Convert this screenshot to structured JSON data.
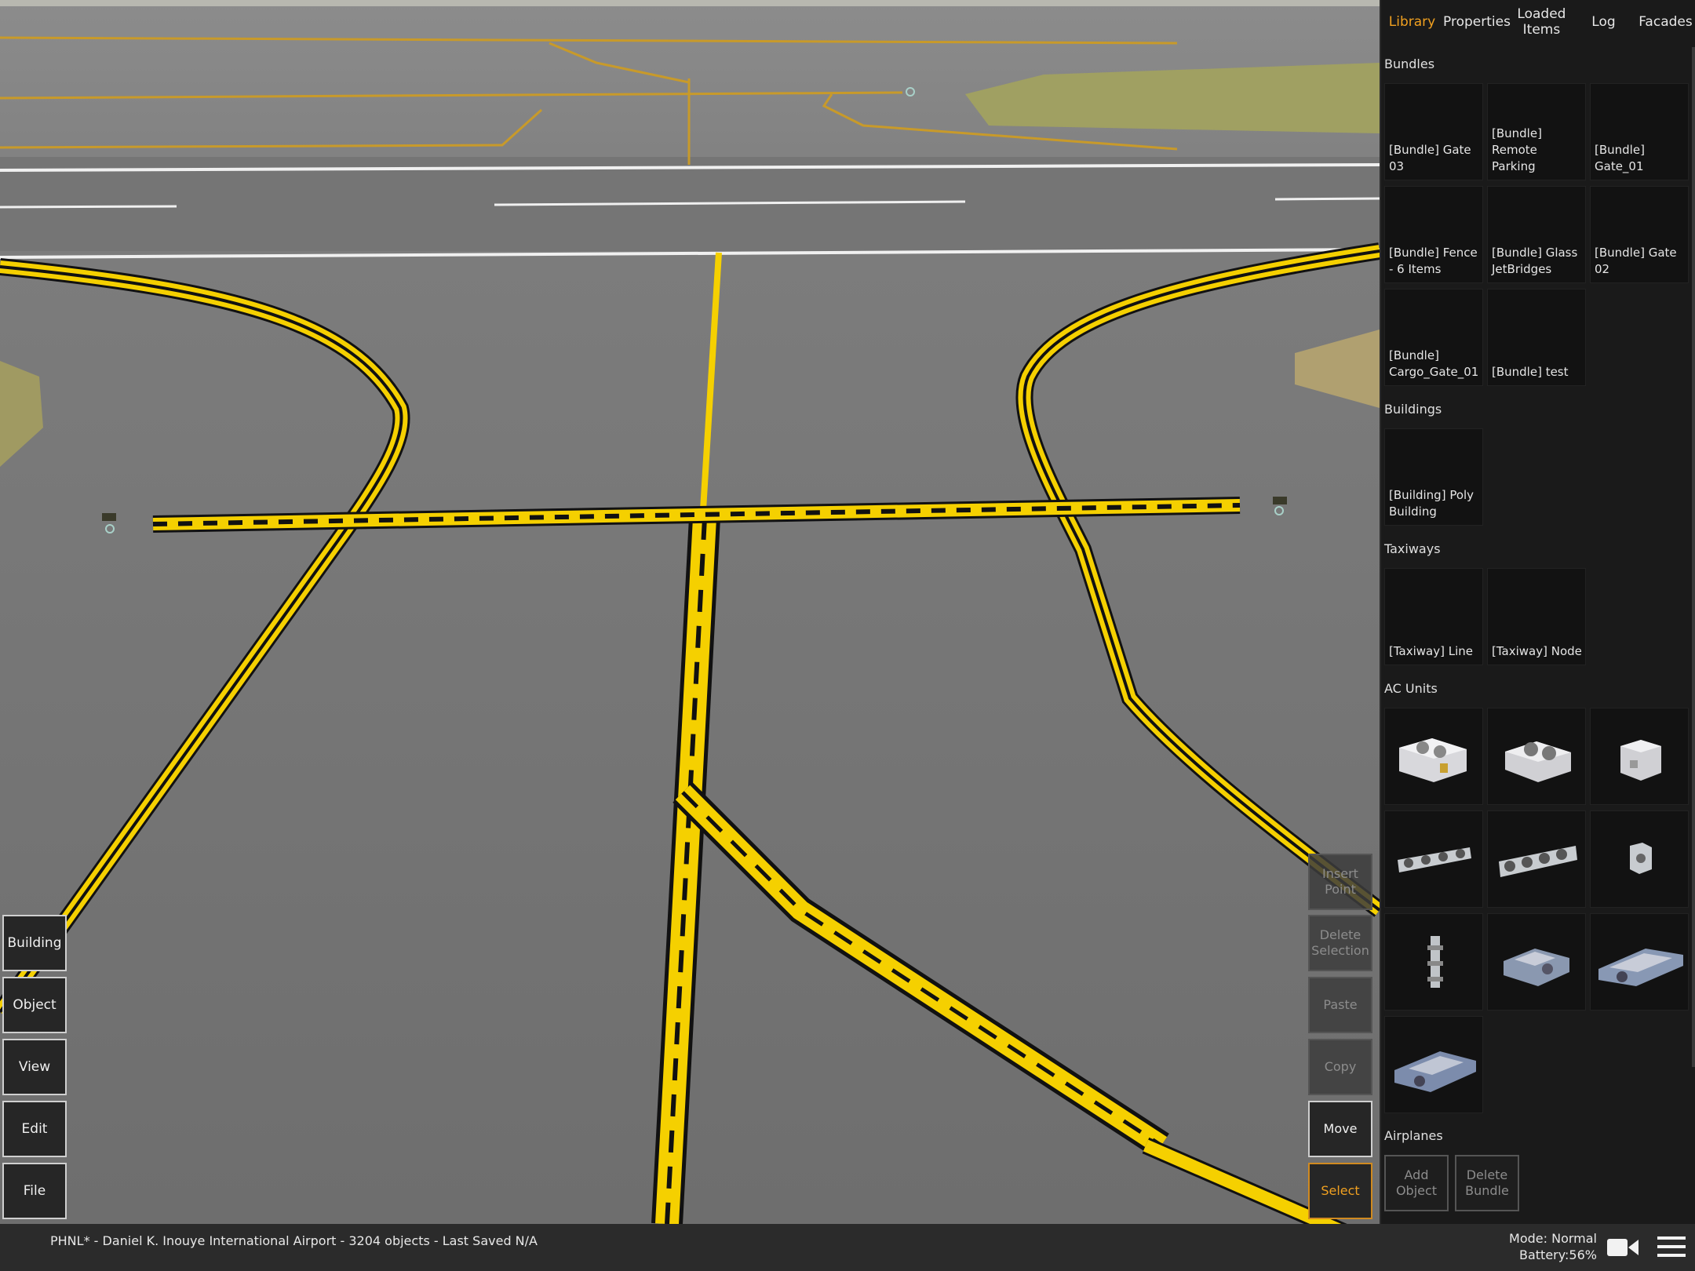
{
  "tabs": [
    {
      "label": "Library",
      "active": true
    },
    {
      "label": "Properties",
      "active": false
    },
    {
      "label": "Loaded Items",
      "active": false
    },
    {
      "label": "Log",
      "active": false
    },
    {
      "label": "Facades",
      "active": false
    }
  ],
  "library": {
    "bundles": {
      "title": "Bundles",
      "items": [
        "[Bundle] Gate 03",
        "[Bundle] Remote Parking",
        "[Bundle] Gate_01",
        "[Bundle] Fence - 6 Items",
        "[Bundle] Glass JetBridges",
        "[Bundle] Gate 02",
        "[Bundle] Cargo_Gate_01",
        "[Bundle] test"
      ]
    },
    "buildings": {
      "title": "Buildings",
      "items": [
        "[Building] Poly Building"
      ]
    },
    "taxiways": {
      "title": "Taxiways",
      "items": [
        "[Taxiway] Line",
        "[Taxiway] Node"
      ]
    },
    "ac_units": {
      "title": "AC Units",
      "items": [
        "ac-unit-1-icon",
        "ac-unit-2-icon",
        "ac-unit-3-icon",
        "ac-unit-row-4-icon",
        "ac-unit-row-5-icon",
        "ac-unit-small-icon",
        "ac-pipe-icon",
        "ac-machinery-1-icon",
        "ac-machinery-2-icon",
        "ac-machinery-3-icon"
      ]
    },
    "airplanes": {
      "title": "Airplanes"
    },
    "actions": {
      "add_object": "Add Object",
      "delete_bundle": "Delete Bundle"
    }
  },
  "left_toolbar": {
    "building": "Building",
    "object": "Object",
    "view": "View",
    "edit": "Edit",
    "file": "File"
  },
  "right_toolbar": {
    "insert_point": "Insert Point",
    "delete_selection": "Delete Selection",
    "paste": "Paste",
    "copy": "Copy",
    "move": "Move",
    "select": "Select"
  },
  "status": {
    "text": "PHNL* - Daniel K. Inouye International Airport - 3204 objects - Last Saved N/A",
    "mode": "Mode: Normal",
    "battery": "Battery:56%"
  },
  "colors": {
    "accent": "#f0a020",
    "taxiline": "#f5d000",
    "panel": "#1a1a1a"
  }
}
